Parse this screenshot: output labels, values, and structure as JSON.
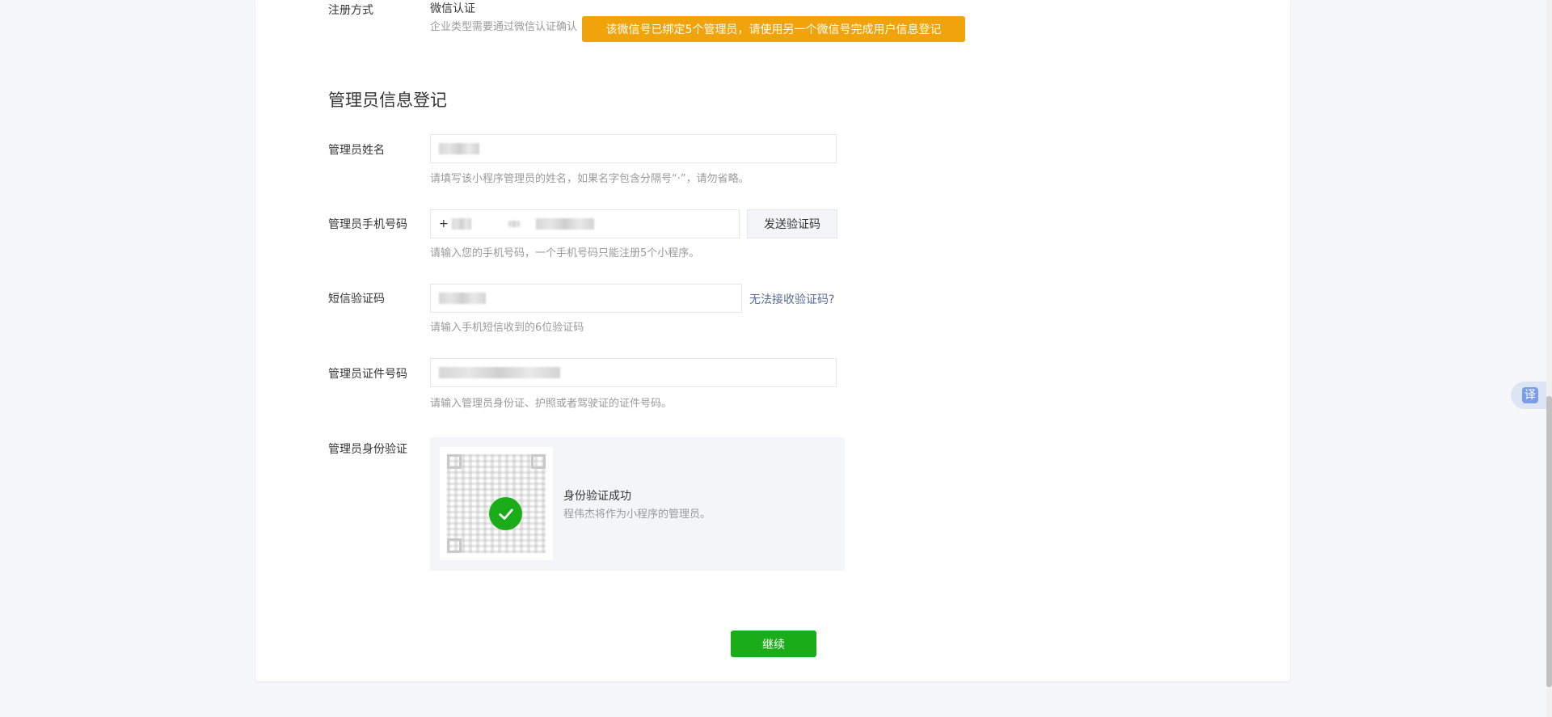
{
  "registration": {
    "label": "注册方式",
    "value": "微信认证",
    "hint": "企业类型需要通过微信认证确认"
  },
  "toast": "该微信号已绑定5个管理员，请使用另一个微信号完成用户信息登记",
  "section_title": "管理员信息登记",
  "name_field": {
    "label": "管理员姓名",
    "hint": "请填写该小程序管理员的姓名，如果名字包含分隔号“·”，请勿省略。"
  },
  "phone_field": {
    "label": "管理员手机号码",
    "prefix": "+",
    "send_code_label": "发送验证码",
    "hint": "请输入您的手机号码，一个手机号码只能注册5个小程序。"
  },
  "sms_field": {
    "label": "短信验证码",
    "help_link": "无法接收验证码?",
    "hint": "请输入手机短信收到的6位验证码"
  },
  "id_field": {
    "label": "管理员证件号码",
    "hint": "请输入管理员身份证、护照或者驾驶证的证件号码。"
  },
  "verify": {
    "label": "管理员身份验证",
    "success_title": "身份验证成功",
    "success_desc": "程伟杰将作为小程序的管理员。"
  },
  "continue_label": "继续",
  "translate_label": "译",
  "colors": {
    "primary": "#1aad19",
    "warning": "#f0a30a",
    "link": "#576b95"
  }
}
